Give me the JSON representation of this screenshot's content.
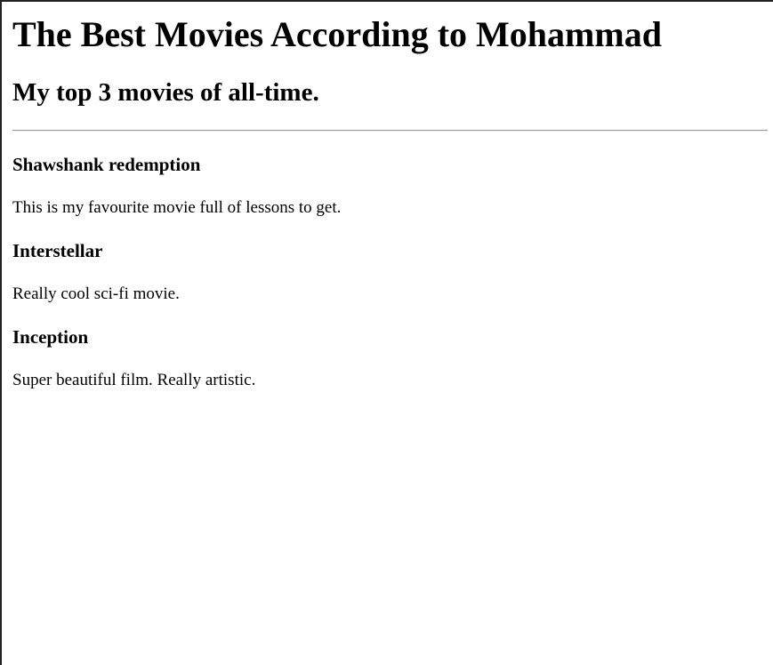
{
  "page": {
    "title": "The Best Movies According to Mohammad",
    "subtitle": "My top 3 movies of all-time."
  },
  "movies": [
    {
      "title": "Shawshank redemption",
      "description": "This is my favourite movie full of lessons to get."
    },
    {
      "title": "Interstellar",
      "description": "Really cool sci-fi movie."
    },
    {
      "title": "Inception",
      "description": "Super beautiful film. Really artistic."
    }
  ]
}
